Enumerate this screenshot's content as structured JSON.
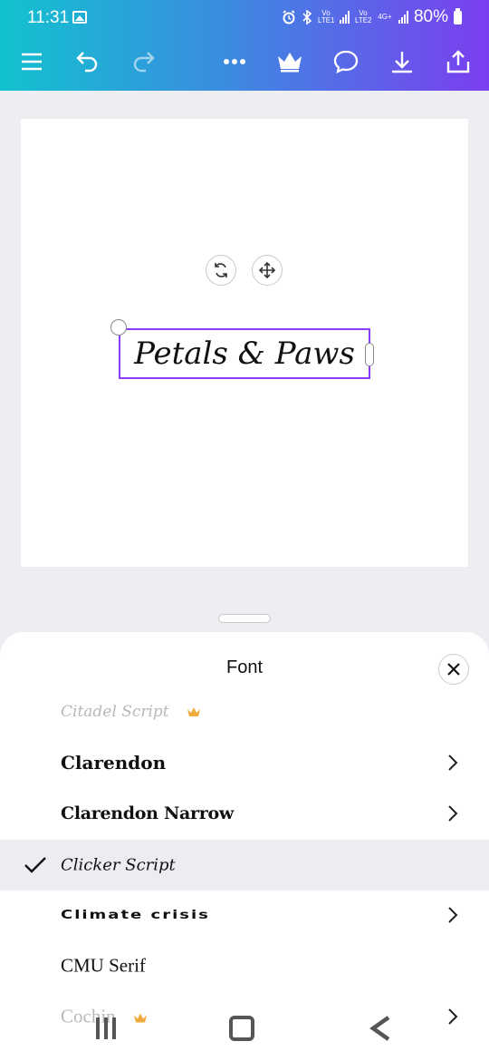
{
  "status_bar": {
    "time": "11:31",
    "volte1": "Vo LTE1",
    "volte2": "Vo LTE2",
    "network": "4G+",
    "battery": "80%"
  },
  "toolbar": {
    "icons": [
      "menu-icon",
      "undo-icon",
      "redo-icon",
      "more-icon",
      "crown-icon",
      "comment-icon",
      "download-icon",
      "share-icon"
    ]
  },
  "canvas": {
    "text": "Petals & Paws",
    "selection_color": "#8b3dff"
  },
  "font_panel": {
    "title": "Font",
    "fonts": [
      {
        "name": "Citadel Script",
        "premium": true,
        "selected": false,
        "has_variants": false,
        "faded": true
      },
      {
        "name": "Clarendon",
        "premium": false,
        "selected": false,
        "has_variants": true
      },
      {
        "name": "Clarendon Narrow",
        "premium": false,
        "selected": false,
        "has_variants": true
      },
      {
        "name": "Clicker Script",
        "premium": false,
        "selected": true,
        "has_variants": false
      },
      {
        "name": "Climate crisis",
        "premium": false,
        "selected": false,
        "has_variants": true
      },
      {
        "name": "CMU Serif",
        "premium": false,
        "selected": false,
        "has_variants": false
      },
      {
        "name": "Cochin",
        "premium": true,
        "selected": false,
        "has_variants": true,
        "faded": true
      }
    ]
  },
  "colors": {
    "accent": "#8b3dff",
    "premium": "#f2a93b"
  }
}
